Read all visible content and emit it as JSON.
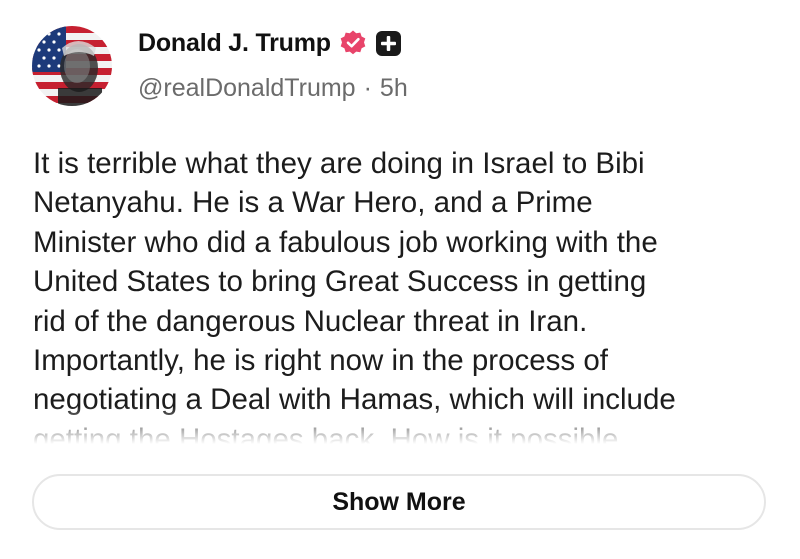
{
  "author": {
    "display_name": "Donald J. Trump",
    "handle": "@realDonaldTrump",
    "separator": "·",
    "time_ago": "5h",
    "verified_badge_icon": "verified-check-icon",
    "add_icon": "plus-icon",
    "avatar_icon": "user-avatar-flag-portrait"
  },
  "post": {
    "text": "It is terrible what they are doing in Israel to Bibi\nNetanyahu. He is a War Hero, and a Prime\nMinister who did a fabulous job working with the\nUnited States to bring Great Success in getting\nrid of the dangerous Nuclear threat in Iran.\nImportantly, he is right now in the process of\nnegotiating a Deal with Hamas, which will include\ngetting the Hostages back. How is it possible"
  },
  "actions": {
    "show_more_label": "Show More"
  },
  "colors": {
    "verified_badge": "#e8446a",
    "text_primary": "#111111",
    "text_secondary": "#6b6b6b",
    "button_border": "#e6e6e6"
  }
}
